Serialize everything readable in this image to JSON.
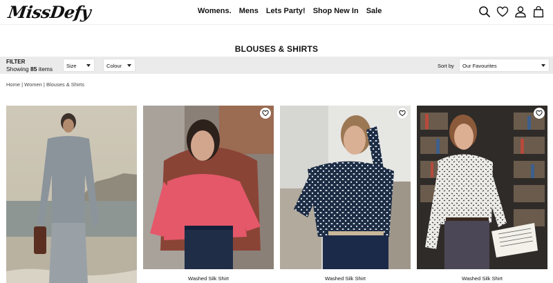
{
  "header": {
    "logo": "MissDefy",
    "nav": [
      "Womens.",
      "Mens",
      "Lets Party!",
      "Shop New In",
      "Sale"
    ],
    "icons": [
      "search-icon",
      "heart-icon",
      "account-icon",
      "bag-icon"
    ]
  },
  "page": {
    "title": "BLOUSES & SHIRTS"
  },
  "filter": {
    "label": "FILTER",
    "showing_prefix": "Showing",
    "count": "85",
    "count_suffix": "items",
    "size_label": "Size",
    "colour_label": "Colour",
    "sort_label": "Sort by",
    "sort_value": "Our Favourites"
  },
  "breadcrumb": "Home | Women | Blouses & Shirts",
  "products": [
    {
      "name": "",
      "palette": "beach"
    },
    {
      "name": "Washed Silk Shirt",
      "palette": "pink"
    },
    {
      "name": "Washed Silk Shirt",
      "palette": "navy"
    },
    {
      "name": "Washed Silk Shirt",
      "palette": "print"
    }
  ],
  "colors": {
    "filter_bg": "#ebebeb",
    "text": "#111111"
  }
}
